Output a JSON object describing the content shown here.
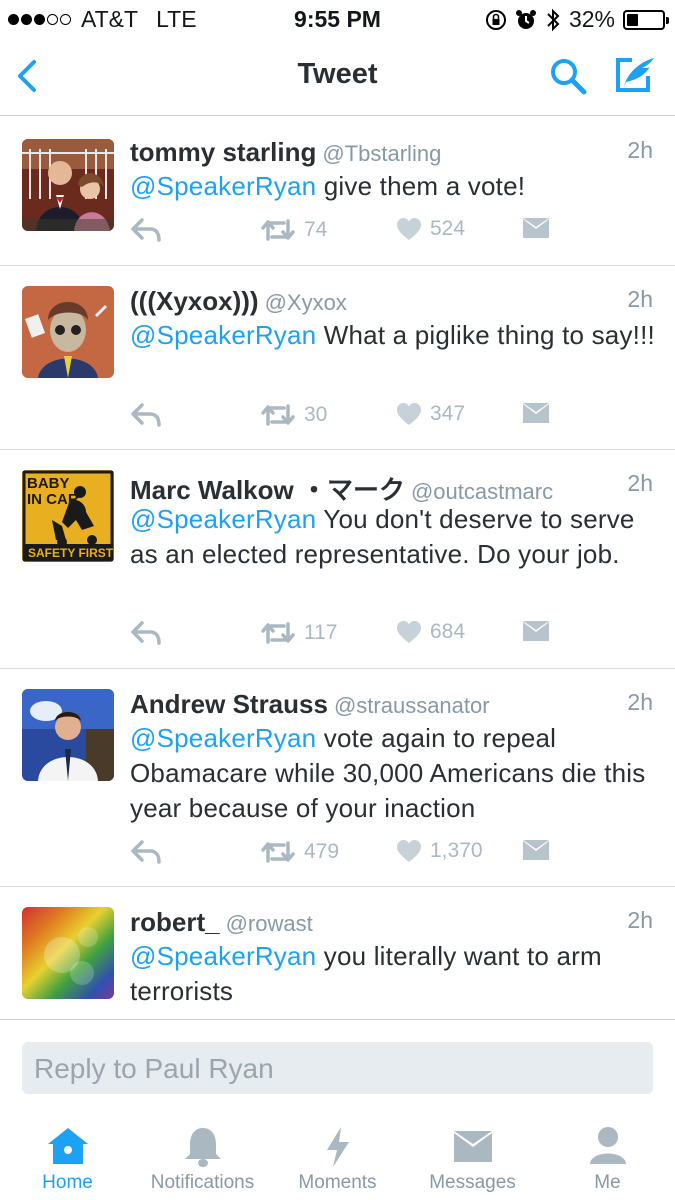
{
  "status_bar": {
    "carrier": "AT&T",
    "network": "LTE",
    "time": "9:55 PM",
    "battery": "32%",
    "battery_fraction": 0.32,
    "signal_bars_filled": 3,
    "signal_bars_total": 5
  },
  "nav": {
    "title": "Tweet",
    "back_icon": "chevron-left-icon",
    "search_icon": "search-icon",
    "compose_icon": "compose-tweet-icon"
  },
  "tweets": [
    {
      "name": "tommy starling",
      "handle": "@Tbstarling",
      "time": "2h",
      "mention": "@SpeakerRyan",
      "text": " give them a vote!",
      "retweets": "74",
      "likes": "524"
    },
    {
      "name": "(((Xyxox)))",
      "handle": "@Xyxox",
      "time": "2h",
      "mention": "@SpeakerRyan",
      "text": " What a piglike thing to say!!!",
      "retweets": "30",
      "likes": "347"
    },
    {
      "name": "Marc Walkow ・マーク",
      "handle": "@outcastmarc",
      "time": "2h",
      "mention": "@SpeakerRyan",
      "text": " You don't deserve to serve as an elected representative. Do your job.",
      "retweets": "117",
      "likes": "684",
      "avatar_text": [
        "BABY",
        "IN CAR",
        "SAFETY FIRST"
      ]
    },
    {
      "name": "Andrew Strauss",
      "handle": "@straussanator",
      "time": "2h",
      "mention": "@SpeakerRyan",
      "text": " vote again to repeal Obamacare while 30,000 Americans die this year because of your inaction",
      "retweets": "479",
      "likes": "1,370"
    },
    {
      "name": "robert_",
      "handle": "@rowast",
      "time": "2h",
      "mention": "@SpeakerRyan",
      "text": " you literally want to arm terrorists"
    }
  ],
  "reply": {
    "placeholder": "Reply to Paul Ryan"
  },
  "tabs": [
    {
      "label": "Home",
      "icon": "home-icon",
      "active": true
    },
    {
      "label": "Notifications",
      "icon": "bell-icon",
      "active": false
    },
    {
      "label": "Moments",
      "icon": "lightning-icon",
      "active": false
    },
    {
      "label": "Messages",
      "icon": "envelope-icon",
      "active": false
    },
    {
      "label": "Me",
      "icon": "person-icon",
      "active": false
    }
  ],
  "colors": {
    "accent": "#1da1f2",
    "muted": "#8899a6",
    "action": "#aab8c2"
  }
}
